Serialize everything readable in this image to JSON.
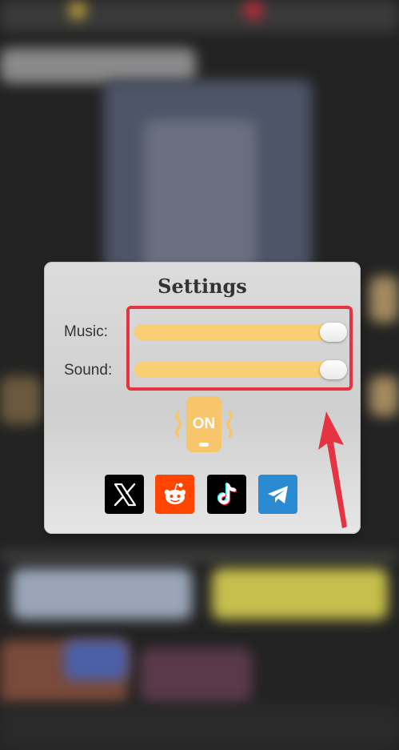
{
  "settings": {
    "title": "Settings",
    "music_label": "Music:",
    "sound_label": "Sound:",
    "music_level": 1.0,
    "sound_level": 1.0,
    "vibration_badge": "ON"
  },
  "socials": [
    {
      "name": "x-icon"
    },
    {
      "name": "reddit-icon"
    },
    {
      "name": "tiktok-icon"
    },
    {
      "name": "telegram-icon"
    }
  ],
  "colors": {
    "slider": "#f9cf73",
    "highlight": "#e53342",
    "vibrate_icon": "#f7c66b",
    "reddit": "#ff4500",
    "telegram": "#2a8bd3"
  }
}
